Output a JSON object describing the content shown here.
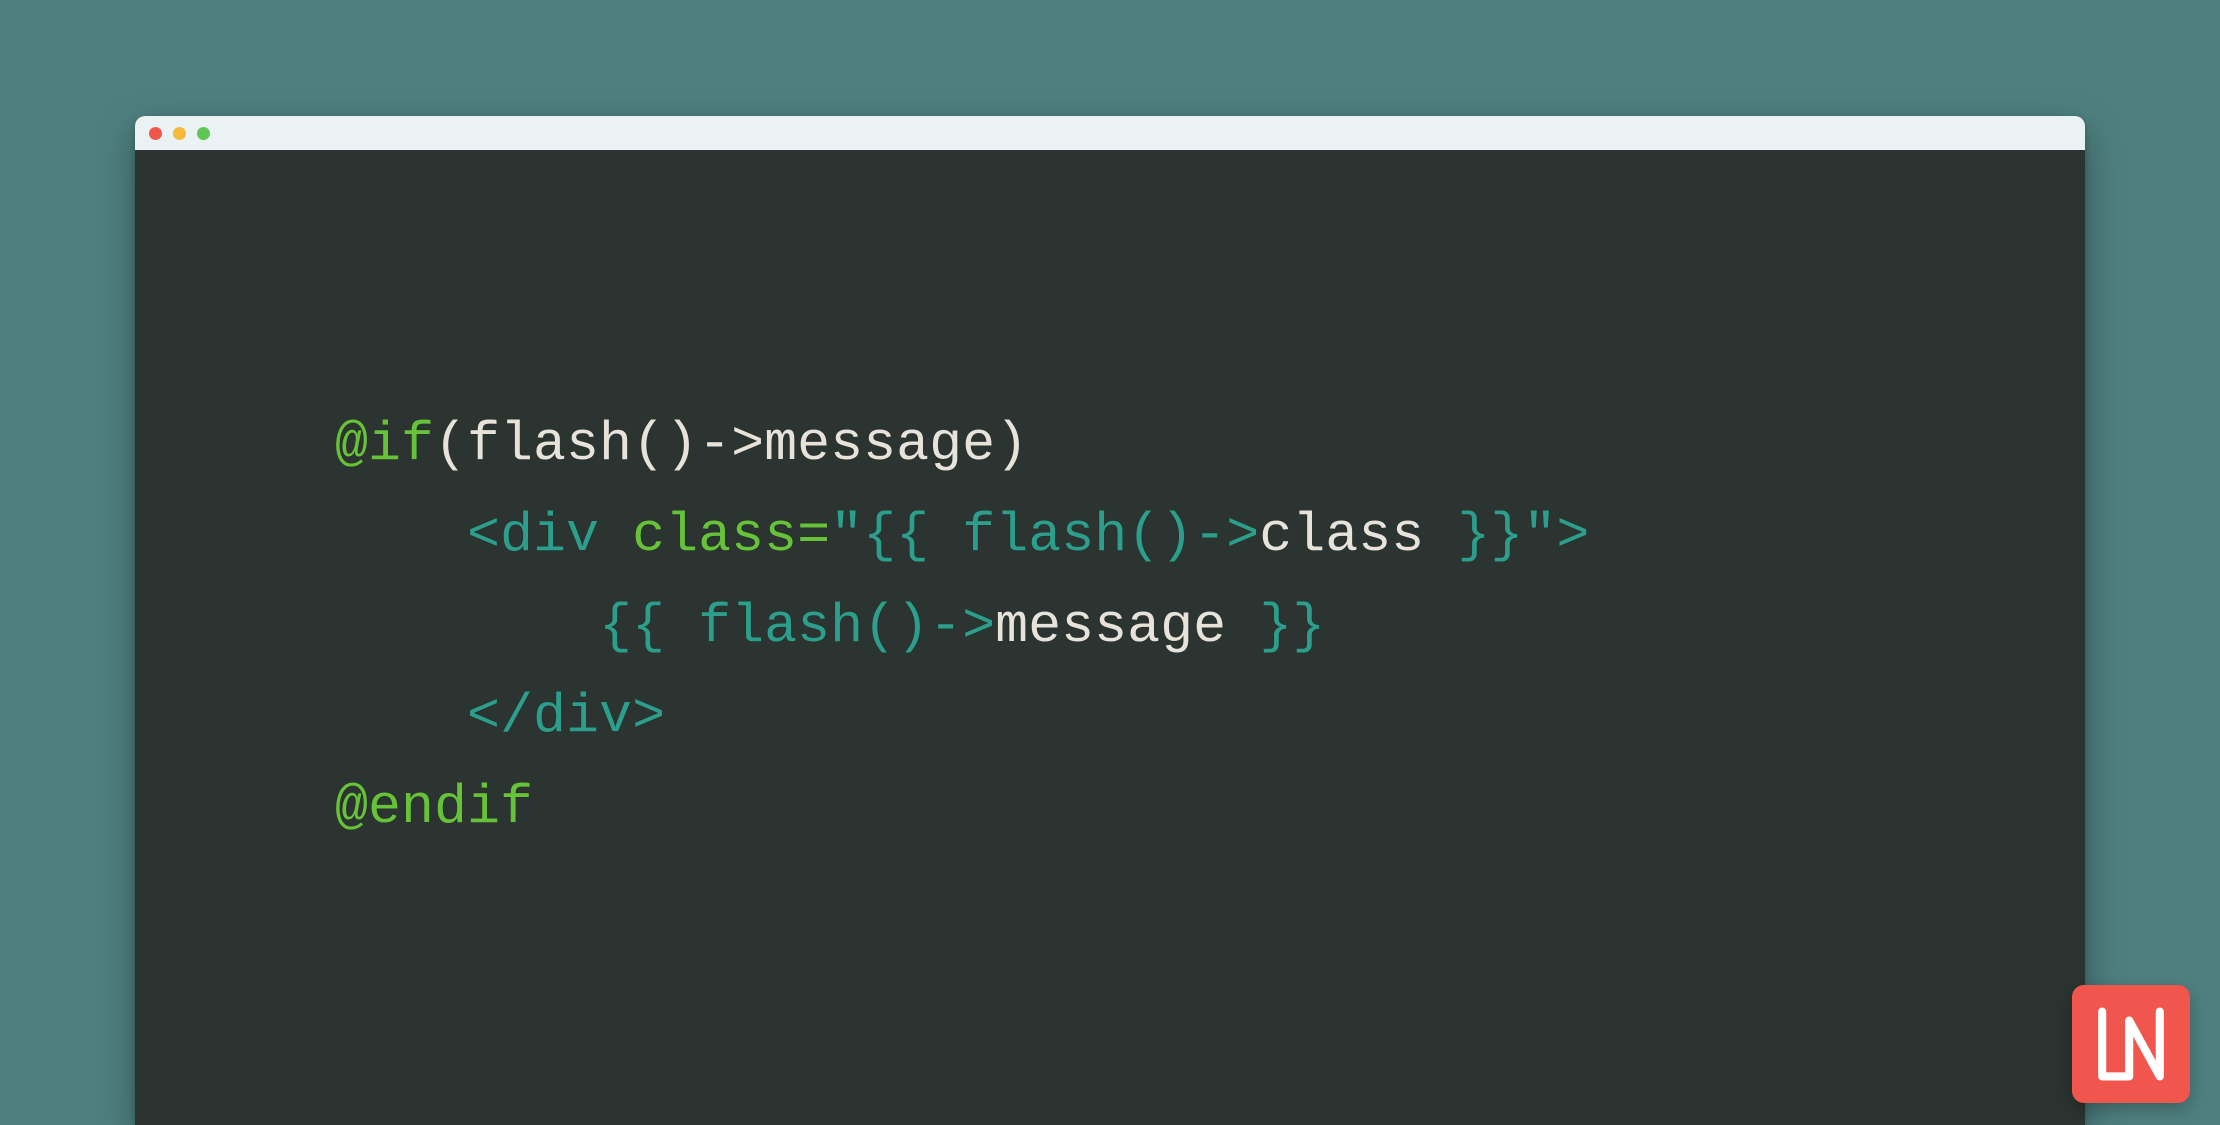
{
  "colors": {
    "page_bg": "#4f8080",
    "editor_bg": "#2b3430",
    "titlebar_bg": "#eaf2f3",
    "traffic_red": "#f1564e",
    "traffic_yellow": "#f6b93b",
    "traffic_green": "#5fc653",
    "syntax_directive": "#67c23a",
    "syntax_tag": "#2c9e8b",
    "syntax_plain": "#e7e3da",
    "logo_bg": "#f1564e"
  },
  "logo_text": "LN",
  "code": {
    "line1": {
      "directive": "@if",
      "rest": "(flash()->message)"
    },
    "line2": {
      "indent": "    ",
      "open_lt": "<",
      "tag": "div",
      "space": " ",
      "attr": "class=",
      "quote_open": "\"",
      "brace_open": "{{ ",
      "fn": "flash()->",
      "prop": "class",
      "brace_close": " }}",
      "quote_close": "\"",
      "close_gt": ">"
    },
    "line3": {
      "indent": "        ",
      "brace_open": "{{ ",
      "fn": "flash()->",
      "prop": "message",
      "brace_close": " }}"
    },
    "line4": {
      "indent": "    ",
      "open": "</",
      "tag": "div",
      "close": ">"
    },
    "line5": {
      "directive": "@endif"
    }
  }
}
